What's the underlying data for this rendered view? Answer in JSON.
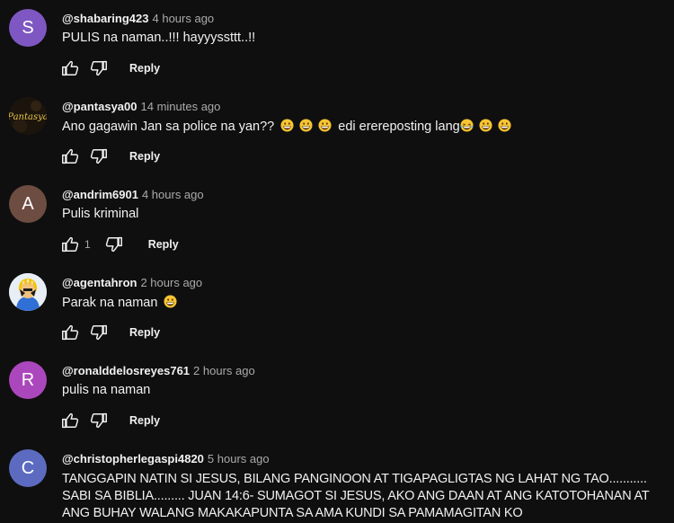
{
  "comments": [
    {
      "author": "@shabaring423",
      "time": "4 hours ago",
      "text": "PULIS na naman..!!! hayyyssttt..!!",
      "avatar_letter": "S",
      "avatar_color": "#7e57c2",
      "likes": "",
      "reply_label": "Reply"
    },
    {
      "author": "@pantasya00",
      "time": "14 minutes ago",
      "text_before_emoji": "Ano gagawin Jan sa police na yan??",
      "text_middle": "edi erereposting lang",
      "avatar_logo_text": "Pantasya",
      "avatar_color": "#1a140c",
      "likes": "",
      "reply_label": "Reply"
    },
    {
      "author": "@andrim6901",
      "time": "4 hours ago",
      "text": "Pulis kriminal",
      "avatar_letter": "A",
      "avatar_color": "#6d4c41",
      "likes": "1",
      "reply_label": "Reply"
    },
    {
      "author": "@agentahron",
      "time": "2 hours ago",
      "text": "Parak na naman",
      "avatar_color": "#e8eef5",
      "likes": "",
      "reply_label": "Reply"
    },
    {
      "author": "@ronalddelosreyes761",
      "time": "2 hours ago",
      "text": "pulis na naman",
      "avatar_letter": "R",
      "avatar_color": "#ab47bc",
      "likes": "",
      "reply_label": "Reply"
    },
    {
      "author": "@christopherlegaspi4820",
      "time": "5 hours ago",
      "text": "TANGGAPIN NATIN SI JESUS, BILANG PANGINOON AT TIGAPAGLIGTAS NG LAHAT NG TAO........... SABI SA BIBLIA......... JUAN 14:6- SUMAGOT SI JESUS, AKO ANG DAAN AT ANG KATOTOHANAN AT ANG BUHAY WALANG MAKAKAPUNTA SA AMA KUNDI SA PAMAMAGITAN KO",
      "avatar_letter": "C",
      "avatar_color": "#5c6bc0"
    }
  ],
  "icons": {
    "like": "thumbs-up-icon",
    "dislike": "thumbs-down-icon",
    "emoji": "grinning-face-emoji",
    "laugh": "tears-of-joy-emoji"
  }
}
